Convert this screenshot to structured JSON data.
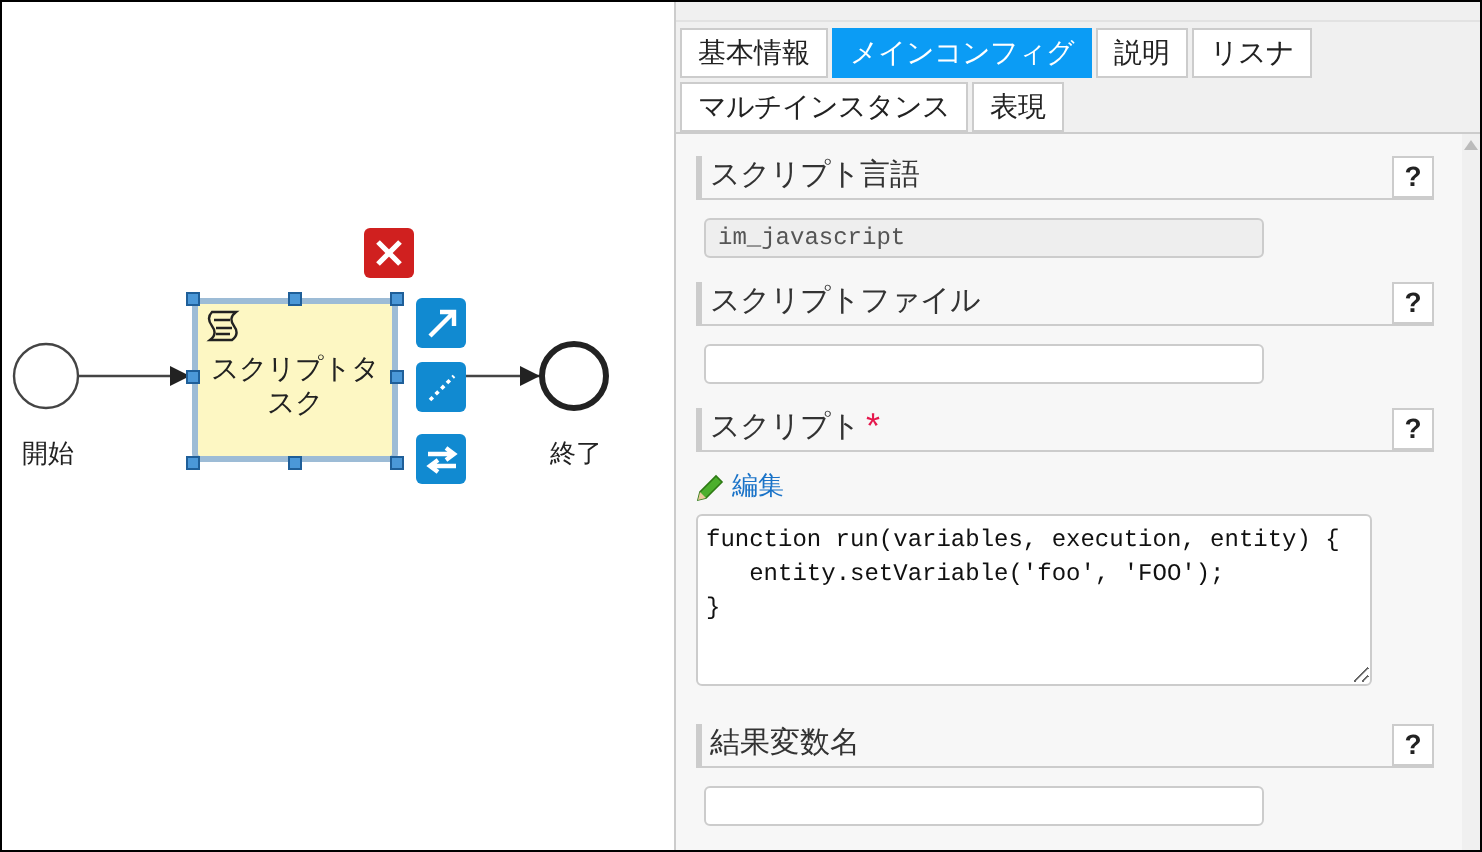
{
  "diagram": {
    "start_event": {
      "label": "開始"
    },
    "task": {
      "label": "スクリプトタスク",
      "selected": true
    },
    "end_event": {
      "label": "終了"
    }
  },
  "tabs": [
    {
      "label": "基本情報",
      "selected": false
    },
    {
      "label": "メインコンフィグ",
      "selected": true
    },
    {
      "label": "説明",
      "selected": false
    },
    {
      "label": "リスナ",
      "selected": false
    },
    {
      "label": "マルチインスタンス",
      "selected": false
    },
    {
      "label": "表現",
      "selected": false
    }
  ],
  "fields": [
    {
      "kind": "input",
      "label": "スクリプト言語",
      "disabled": true,
      "value": "im_javascript",
      "help": "?"
    },
    {
      "kind": "input",
      "label": "スクリプトファイル",
      "disabled": false,
      "help": "?"
    },
    {
      "kind": "code",
      "label": "スクリプト",
      "required_mark": "*",
      "disabled": false,
      "edit_link": "編集",
      "value": "function run(variables, execution, entity) {\n   entity.setVariable('foo', 'FOO');\n}",
      "help": "?"
    },
    {
      "kind": "input",
      "label": "結果変数名",
      "disabled": false,
      "help": "?"
    }
  ]
}
